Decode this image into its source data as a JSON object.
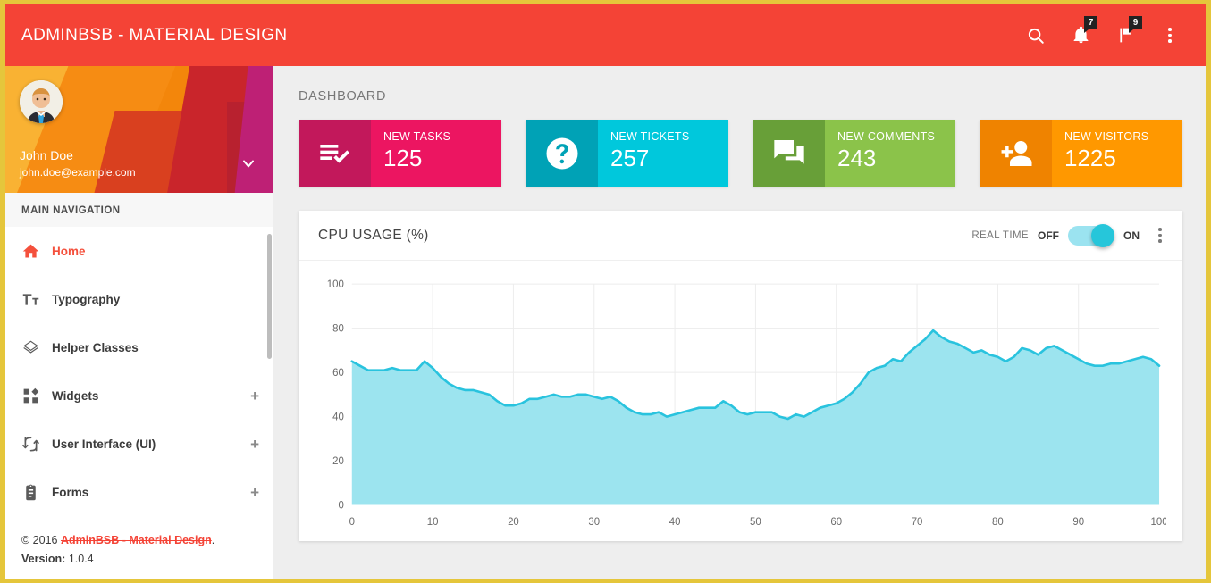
{
  "topbar": {
    "brand": "ADMINBSB - MATERIAL DESIGN",
    "search_icon": "search-icon",
    "notifications_icon": "bell-icon",
    "notifications_badge": "7",
    "tasks_icon": "flag-icon",
    "tasks_badge": "9",
    "more_icon": "more-vertical-icon"
  },
  "sidebar": {
    "user": {
      "name": "John Doe",
      "email": "john.doe@example.com",
      "avatar": "user-avatar",
      "caret": "chevron-down-icon"
    },
    "nav_title": "MAIN NAVIGATION",
    "items": [
      {
        "label": "Home",
        "icon": "home-icon",
        "expand": "",
        "active": true
      },
      {
        "label": "Typography",
        "icon": "text-format-icon",
        "expand": "",
        "active": false
      },
      {
        "label": "Helper Classes",
        "icon": "layers-icon",
        "expand": "",
        "active": false
      },
      {
        "label": "Widgets",
        "icon": "widgets-icon",
        "expand": "+",
        "active": false
      },
      {
        "label": "User Interface (UI)",
        "icon": "swap-icon",
        "expand": "+",
        "active": false
      },
      {
        "label": "Forms",
        "icon": "clipboard-icon",
        "expand": "+",
        "active": false
      }
    ],
    "footer": {
      "copyright_prefix": "© 2016 ",
      "link": "AdminBSB - Material Design",
      "copyright_suffix": ".",
      "version_label": "Version:",
      "version_value": "1.0.4"
    }
  },
  "main": {
    "page_title": "DASHBOARD",
    "cards": [
      {
        "label": "NEW TASKS",
        "value": "125",
        "icon": "playlist-check-icon",
        "color": "#EC1561",
        "icon_bg": "#C2185B"
      },
      {
        "label": "NEW TICKETS",
        "value": "257",
        "icon": "help-circle-icon",
        "color": "#00C8DC",
        "icon_bg": "#00A2B6"
      },
      {
        "label": "NEW COMMENTS",
        "value": "243",
        "icon": "forum-icon",
        "color": "#8BC34A",
        "icon_bg": "#689F38"
      },
      {
        "label": "NEW VISITORS",
        "value": "1225",
        "icon": "person-add-icon",
        "color": "#FF9800",
        "icon_bg": "#EF8300"
      }
    ],
    "chart_card": {
      "title": "CPU USAGE (%)",
      "realtime_label": "REAL TIME",
      "off_label": "OFF",
      "on_label": "ON",
      "toggle_state": "on",
      "more_icon": "more-vertical-icon"
    }
  },
  "chart_data": {
    "type": "area",
    "title": "CPU USAGE (%)",
    "xlabel": "",
    "ylabel": "",
    "xlim": [
      0,
      100
    ],
    "ylim": [
      0,
      100
    ],
    "xticks": [
      0,
      10,
      20,
      30,
      40,
      50,
      60,
      70,
      80,
      90,
      100
    ],
    "yticks": [
      0,
      20,
      40,
      60,
      80,
      100
    ],
    "grid": true,
    "legend": "none",
    "line_color": "#29C3DE",
    "fill_color": "#9CE4EF",
    "series": [
      {
        "name": "CPU Usage",
        "x": [
          0,
          1,
          2,
          3,
          4,
          5,
          6,
          7,
          8,
          9,
          10,
          11,
          12,
          13,
          14,
          15,
          16,
          17,
          18,
          19,
          20,
          21,
          22,
          23,
          24,
          25,
          26,
          27,
          28,
          29,
          30,
          31,
          32,
          33,
          34,
          35,
          36,
          37,
          38,
          39,
          40,
          41,
          42,
          43,
          44,
          45,
          46,
          47,
          48,
          49,
          50,
          51,
          52,
          53,
          54,
          55,
          56,
          57,
          58,
          59,
          60,
          61,
          62,
          63,
          64,
          65,
          66,
          67,
          68,
          69,
          70,
          71,
          72,
          73,
          74,
          75,
          76,
          77,
          78,
          79,
          80,
          81,
          82,
          83,
          84,
          85,
          86,
          87,
          88,
          89,
          90,
          91,
          92,
          93,
          94,
          95,
          96,
          97,
          98,
          99,
          100
        ],
        "values": [
          65,
          63,
          61,
          61,
          61,
          62,
          61,
          61,
          61,
          65,
          62,
          58,
          55,
          53,
          52,
          52,
          51,
          50,
          47,
          45,
          45,
          46,
          48,
          48,
          49,
          50,
          49,
          49,
          50,
          50,
          49,
          48,
          49,
          47,
          44,
          42,
          41,
          41,
          42,
          40,
          41,
          42,
          43,
          44,
          44,
          44,
          47,
          45,
          42,
          41,
          42,
          42,
          42,
          40,
          39,
          41,
          40,
          42,
          44,
          45,
          46,
          48,
          51,
          55,
          60,
          62,
          63,
          66,
          65,
          69,
          72,
          75,
          79,
          76,
          74,
          73,
          71,
          69,
          70,
          68,
          67,
          65,
          67,
          71,
          70,
          68,
          71,
          72,
          70,
          68,
          66,
          64,
          63,
          63,
          64,
          64,
          65,
          66,
          67,
          66,
          63
        ]
      }
    ]
  }
}
